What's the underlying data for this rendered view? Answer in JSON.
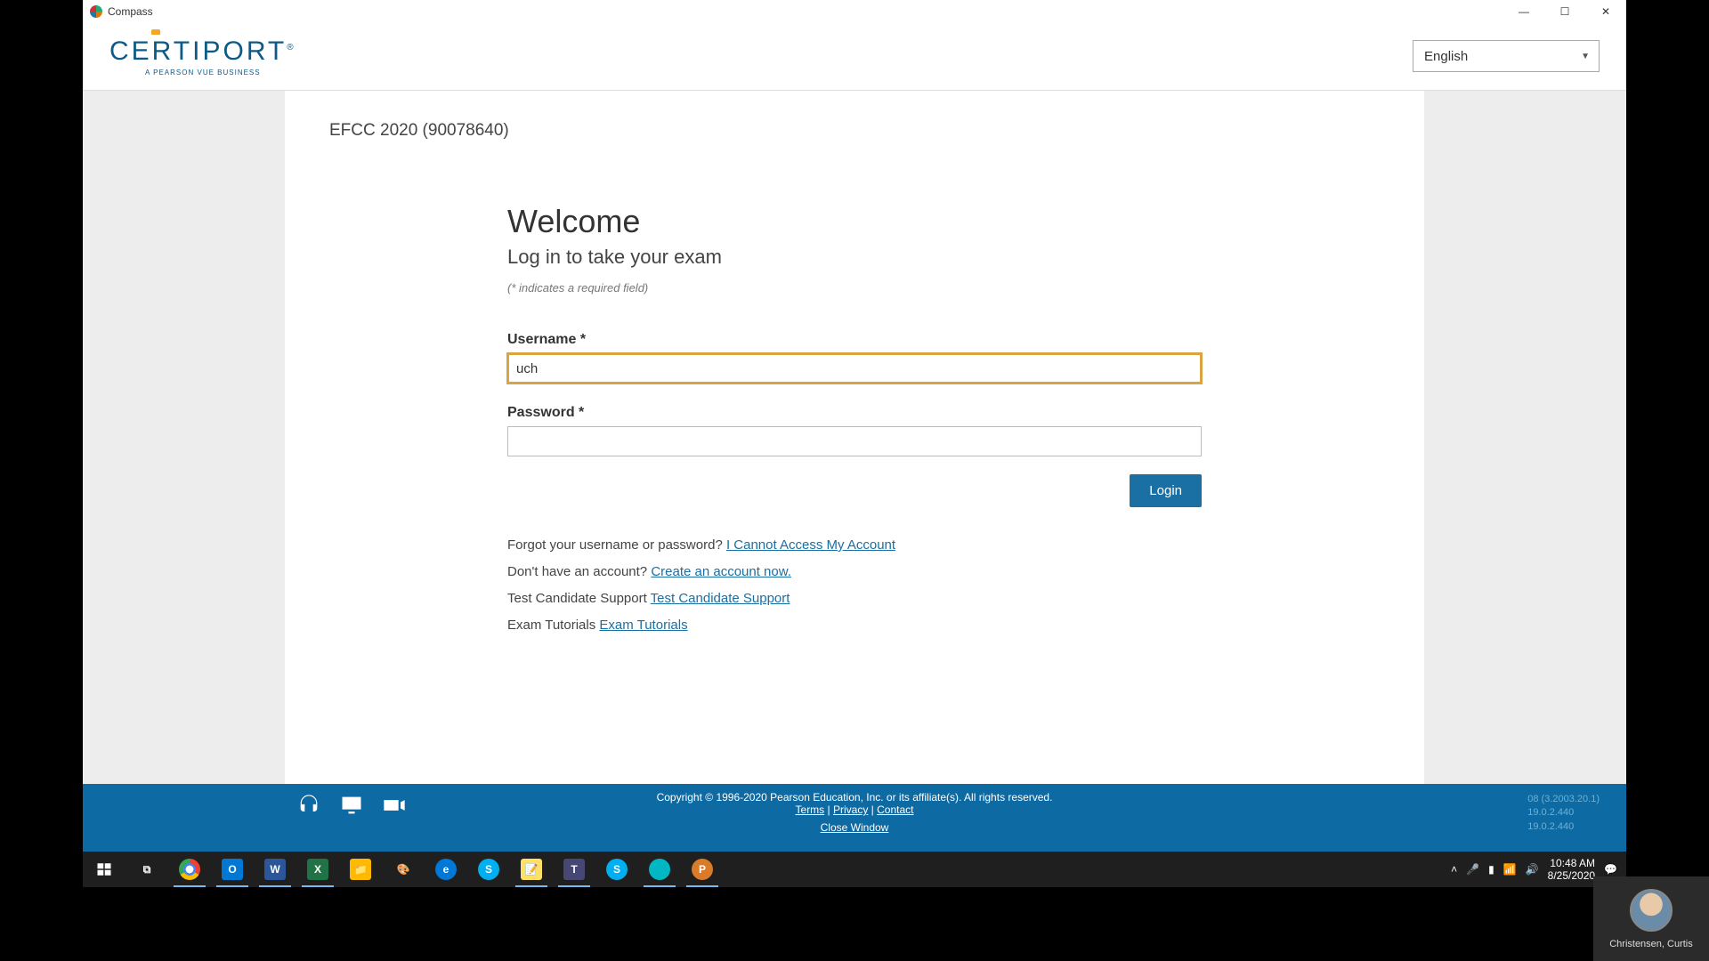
{
  "window": {
    "title": "Compass"
  },
  "header": {
    "logo_main": "CERTIPORT",
    "logo_reg": "®",
    "logo_sub": "A PEARSON VUE BUSINESS",
    "language": "English"
  },
  "page": {
    "center_heading": "EFCC 2020 (90078640)",
    "welcome": "Welcome",
    "subhead": "Log in to take your exam",
    "req_note": "(* indicates a required field)",
    "username_label": "Username *",
    "username_value": "uch",
    "password_label": "Password *",
    "password_value": "",
    "login_label": "Login",
    "forgot_prompt": "Forgot your username or password? ",
    "forgot_link": "I Cannot Access My Account",
    "noacct_prompt": "Don't have an account? ",
    "noacct_link": "Create an account now.",
    "support_prompt": "Test Candidate Support ",
    "support_link": "Test Candidate Support",
    "tutorials_prompt": "Exam Tutorials ",
    "tutorials_link": "Exam Tutorials"
  },
  "footer": {
    "copyright": "Copyright © 1996-2020 Pearson Education, Inc. or its affiliate(s). All rights reserved.",
    "terms": "Terms",
    "privacy": "Privacy",
    "contact": "Contact",
    "sep": "  |  ",
    "close": "Close Window",
    "ver1": "08 (3.2003.20.1)",
    "ver2": "19.0.2.440",
    "ver3": "19.0.2.440"
  },
  "taskbar": {
    "time": "10:48 AM",
    "date": "8/25/2020"
  },
  "participant": {
    "name": "Christensen, Curtis"
  }
}
